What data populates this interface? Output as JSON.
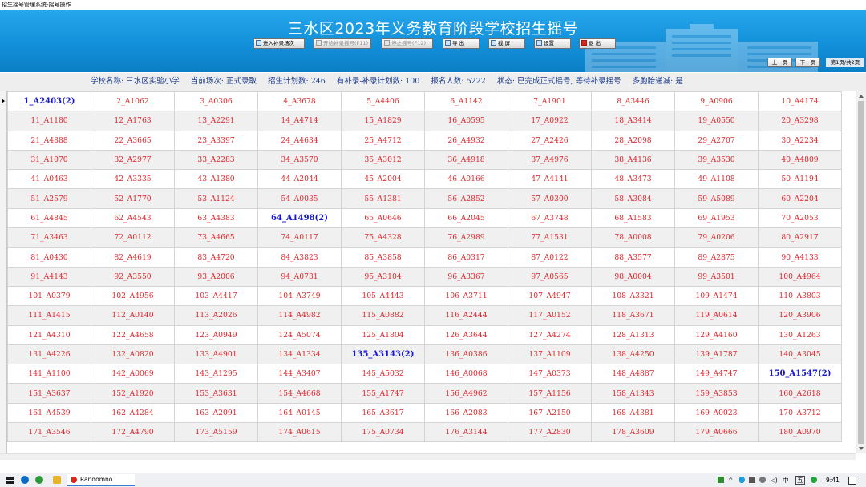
{
  "window": {
    "title": "招生摇号管理系统-摇号操作"
  },
  "banner": {
    "title": "三水区2023年义务教育阶段学校招生摇号"
  },
  "toolbar": {
    "buttons": [
      {
        "label": "进入补录场次",
        "enabled": true
      },
      {
        "label": "开始补录摇号(F11)",
        "enabled": false
      },
      {
        "label": "停止摇号(F12)",
        "enabled": false
      },
      {
        "label": "导 出",
        "enabled": true
      },
      {
        "label": "截 屏",
        "enabled": true
      },
      {
        "label": "设置",
        "enabled": true
      },
      {
        "label": "退 出",
        "enabled": true
      }
    ]
  },
  "pager": {
    "prev_label": "上一页",
    "next_label": "下一页",
    "page_info": "第1页/共2页"
  },
  "info": {
    "school": "学校名称: 三水区实验小学",
    "session": "当前场次: 正式录取",
    "plan": "招生计划数: 246",
    "supplement": "有补录-补录计划数: 100",
    "applicants": "报名人数: 5222",
    "status": "状态: 已完成正式摇号, 等待补录摇号",
    "multi_birth": "多胞胎递减: 是"
  },
  "grid": {
    "rows": [
      [
        "1_A2403(2)",
        "2_A1062",
        "3_A0306",
        "4_A3678",
        "5_A4406",
        "6_A1142",
        "7_A1901",
        "8_A3446",
        "9_A0906",
        "10_A4174"
      ],
      [
        "11_A1180",
        "12_A1763",
        "13_A2291",
        "14_A4714",
        "15_A1829",
        "16_A0595",
        "17_A0922",
        "18_A3414",
        "19_A0550",
        "20_A3298"
      ],
      [
        "21_A4888",
        "22_A3665",
        "23_A3397",
        "24_A4634",
        "25_A4712",
        "26_A4932",
        "27_A2426",
        "28_A2098",
        "29_A2707",
        "30_A2234"
      ],
      [
        "31_A1070",
        "32_A2977",
        "33_A2283",
        "34_A3570",
        "35_A3012",
        "36_A4918",
        "37_A4976",
        "38_A4136",
        "39_A3530",
        "40_A4809"
      ],
      [
        "41_A0463",
        "42_A3335",
        "43_A1380",
        "44_A2044",
        "45_A2004",
        "46_A0166",
        "47_A4141",
        "48_A3473",
        "49_A1108",
        "50_A1194"
      ],
      [
        "51_A2579",
        "52_A1770",
        "53_A1124",
        "54_A0035",
        "55_A1381",
        "56_A2852",
        "57_A0300",
        "58_A3084",
        "59_A5089",
        "60_A2204"
      ],
      [
        "61_A4845",
        "62_A4543",
        "63_A4383",
        "64_A1498(2)",
        "65_A0646",
        "66_A2045",
        "67_A3748",
        "68_A1583",
        "69_A1953",
        "70_A2053"
      ],
      [
        "71_A3463",
        "72_A0112",
        "73_A4665",
        "74_A0117",
        "75_A4328",
        "76_A2989",
        "77_A1531",
        "78_A0008",
        "79_A0206",
        "80_A2917"
      ],
      [
        "81_A0430",
        "82_A4619",
        "83_A4720",
        "84_A3823",
        "85_A3858",
        "86_A0317",
        "87_A0122",
        "88_A3577",
        "89_A2875",
        "90_A4133"
      ],
      [
        "91_A4143",
        "92_A3550",
        "93_A2006",
        "94_A0731",
        "95_A3104",
        "96_A3367",
        "97_A0565",
        "98_A0004",
        "99_A3501",
        "100_A4964"
      ],
      [
        "101_A0379",
        "102_A4956",
        "103_A4417",
        "104_A3749",
        "105_A4443",
        "106_A3711",
        "107_A4947",
        "108_A3321",
        "109_A1474",
        "110_A3803"
      ],
      [
        "111_A1415",
        "112_A0140",
        "113_A2026",
        "114_A4982",
        "115_A0882",
        "116_A2444",
        "117_A0152",
        "118_A3671",
        "119_A0614",
        "120_A3906"
      ],
      [
        "121_A4310",
        "122_A4658",
        "123_A0949",
        "124_A5074",
        "125_A1804",
        "126_A3644",
        "127_A4274",
        "128_A1313",
        "129_A4160",
        "130_A1263"
      ],
      [
        "131_A4226",
        "132_A0820",
        "133_A4901",
        "134_A1334",
        "135_A3143(2)",
        "136_A0386",
        "137_A1109",
        "138_A4250",
        "139_A1787",
        "140_A3045"
      ],
      [
        "141_A1100",
        "142_A0069",
        "143_A1295",
        "144_A3407",
        "145_A5032",
        "146_A0068",
        "147_A0373",
        "148_A4887",
        "149_A4747",
        "150_A1547(2)"
      ],
      [
        "151_A3637",
        "152_A1920",
        "153_A3631",
        "154_A4668",
        "155_A1747",
        "156_A4962",
        "157_A1156",
        "158_A1343",
        "159_A3853",
        "160_A2618"
      ],
      [
        "161_A4539",
        "162_A4284",
        "163_A2091",
        "164_A0145",
        "165_A3617",
        "166_A2083",
        "167_A2150",
        "168_A4381",
        "169_A0023",
        "170_A3712"
      ],
      [
        "171_A3546",
        "172_A4790",
        "173_A5159",
        "174_A0615",
        "175_A0734",
        "176_A3144",
        "177_A2830",
        "178_A3609",
        "179_A0666",
        "180_A0970"
      ]
    ],
    "highlight_color": "#1818d4",
    "normal_color": "#e0262a"
  },
  "taskbar": {
    "app_label": "Randomno",
    "ime_label": "中",
    "ime_mode": "五",
    "time": "9:41"
  },
  "colors": {
    "banner": "#1a9ae0",
    "info_text": "#1c3c8c"
  }
}
